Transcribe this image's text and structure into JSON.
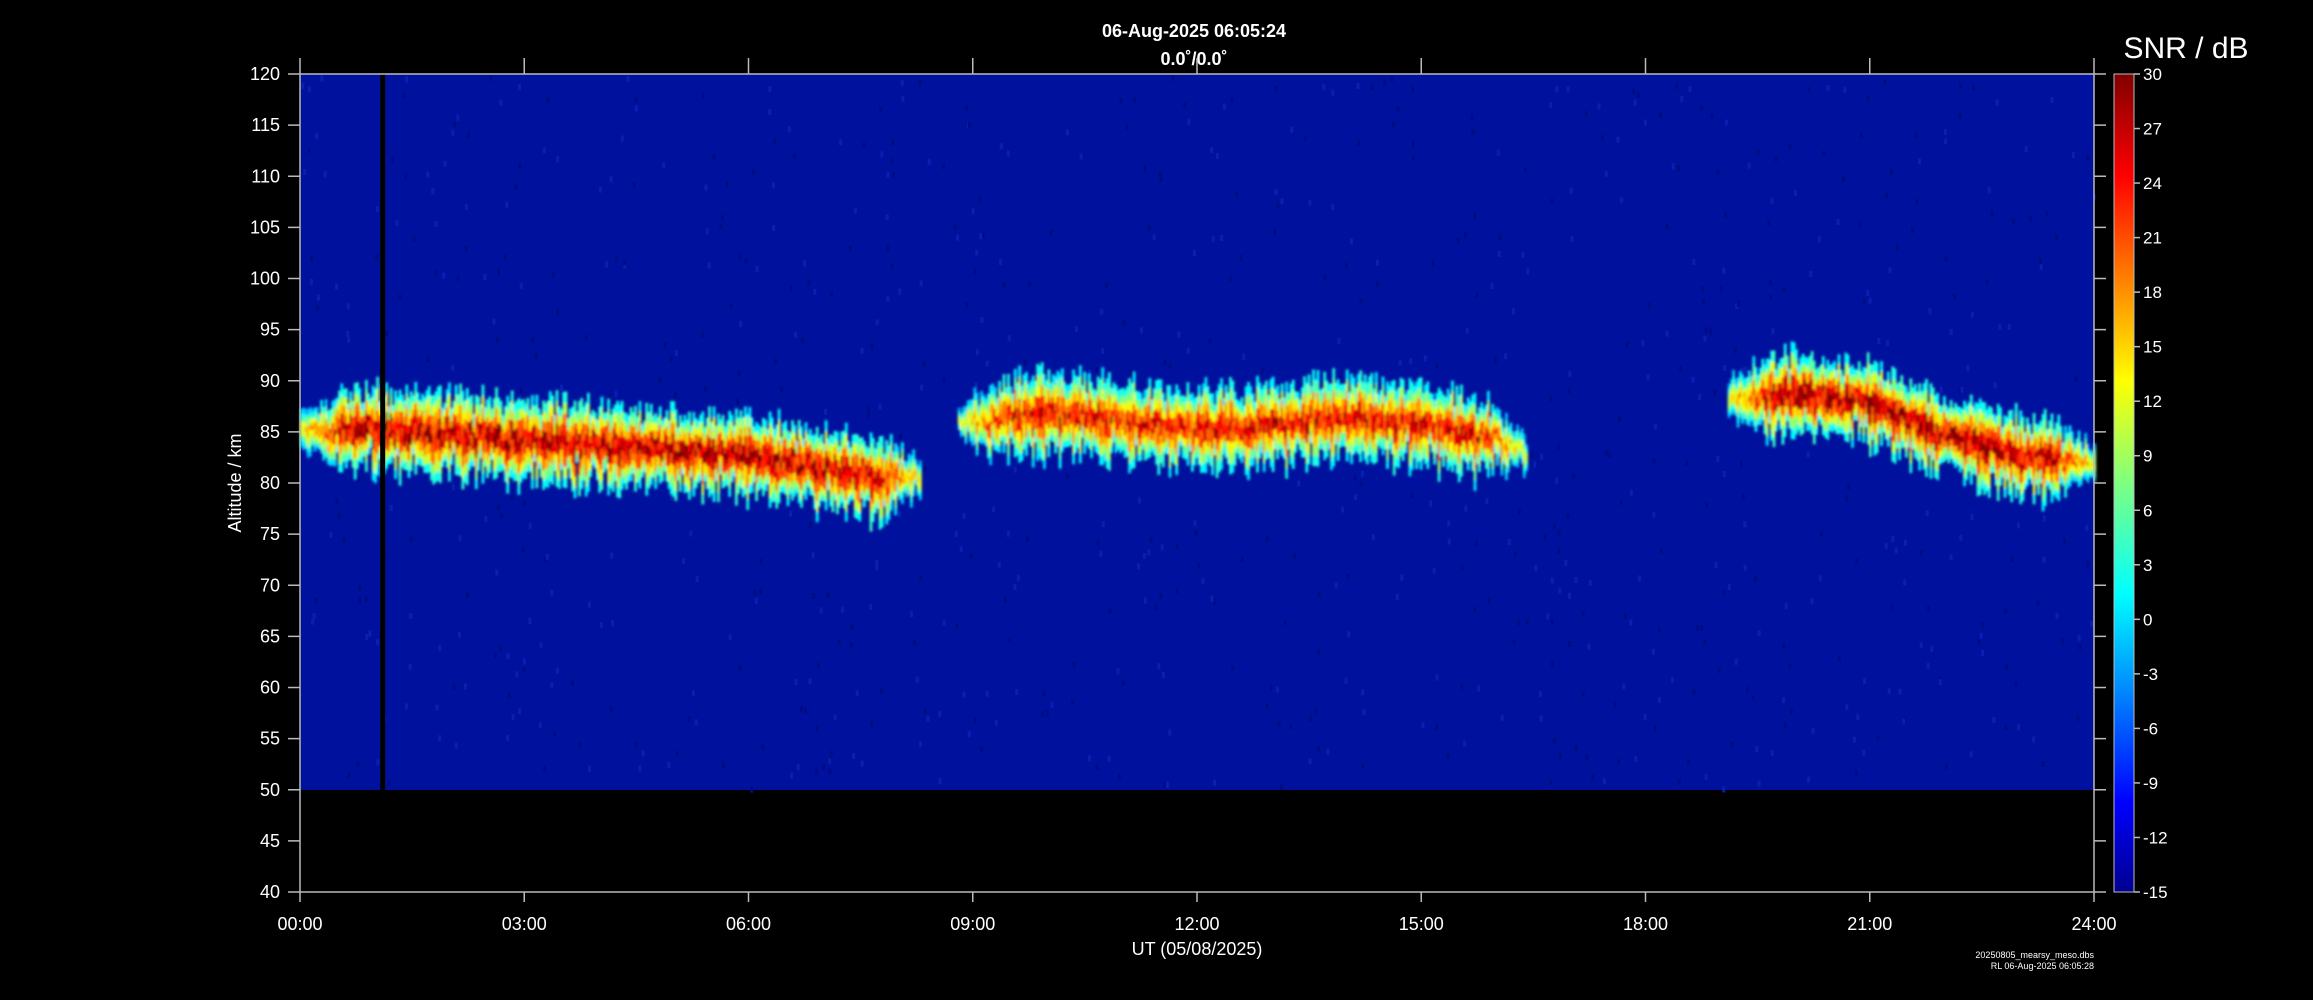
{
  "header": {
    "title": "06-Aug-2025 06:05:24",
    "subtitle": "0.0˚/0.0˚",
    "colorbar_label": "SNR / dB"
  },
  "footer": {
    "filename": "20250805_mearsy_meso.dbs",
    "stamp": "RL 06-Aug-2025 06:05:28"
  },
  "chart_data": {
    "type": "heatmap",
    "title": "06-Aug-2025 06:05:24",
    "subtitle": "0.0˚/0.0˚",
    "xlabel": "UT (05/08/2025)",
    "ylabel": "Altitude / km",
    "x_range_hours": [
      0,
      24
    ],
    "x_ticks": [
      "00:00",
      "03:00",
      "06:00",
      "09:00",
      "12:00",
      "15:00",
      "18:00",
      "21:00",
      "24:00"
    ],
    "ylim": [
      40,
      120
    ],
    "y_ticks": [
      40,
      45,
      50,
      55,
      60,
      65,
      70,
      75,
      80,
      85,
      90,
      95,
      100,
      105,
      110,
      115,
      120
    ],
    "data_altitude_range": [
      50,
      120
    ],
    "colorbar": {
      "label": "SNR / dB",
      "range": [
        -15,
        30
      ],
      "ticks": [
        -15,
        -12,
        -9,
        -6,
        -3,
        0,
        3,
        6,
        9,
        12,
        15,
        18,
        21,
        24,
        27,
        30
      ],
      "colormap": "jet"
    },
    "background_snr": -14,
    "gap_time_hour": 1.1,
    "echo_layers": [
      {
        "start_hour": 0.0,
        "end_hour": 8.3,
        "center_altitude": [
          [
            0,
            85
          ],
          [
            1,
            85.5
          ],
          [
            2,
            85
          ],
          [
            3,
            84.5
          ],
          [
            4,
            84
          ],
          [
            5,
            83.5
          ],
          [
            6,
            83
          ],
          [
            7,
            81.5
          ],
          [
            8.3,
            80.5
          ]
        ],
        "thickness_km": 4,
        "peak_snr": 30
      },
      {
        "start_hour": 8.8,
        "end_hour": 16.4,
        "center_altitude": [
          [
            8.8,
            86
          ],
          [
            10,
            87
          ],
          [
            11,
            86.5
          ],
          [
            12,
            85.5
          ],
          [
            13,
            86
          ],
          [
            14,
            86.5
          ],
          [
            15,
            86
          ],
          [
            16,
            84.5
          ],
          [
            16.4,
            83
          ]
        ],
        "thickness_km": 4,
        "peak_snr": 27
      },
      {
        "start_hour": 19.1,
        "end_hour": 24.0,
        "center_altitude": [
          [
            19.1,
            88.5
          ],
          [
            20,
            89
          ],
          [
            21,
            88
          ],
          [
            22,
            85
          ],
          [
            23,
            83
          ],
          [
            24,
            82
          ]
        ],
        "thickness_km": 4,
        "peak_snr": 30
      }
    ]
  }
}
